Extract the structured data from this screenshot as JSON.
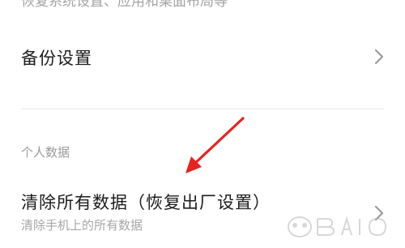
{
  "top_clipped_text": "恢复系统设置、应用和桌面布局等",
  "backup_row": {
    "title": "备份设置",
    "chevron_icon": "chevron-right-icon"
  },
  "personal_section": {
    "header": "个人数据"
  },
  "factory_reset_row": {
    "title": "清除所有数据（恢复出厂设置）",
    "subtitle": "清除手机上的所有数据",
    "chevron_icon": "chevron-right-icon"
  },
  "annotation": {
    "arrow_color": "#e8231f"
  },
  "watermark": {
    "icon": "baidu-jingyan-watermark"
  },
  "colors": {
    "background": "#ffffff",
    "title_text": "#1c1c1c",
    "secondary_text": "#a6a6a6",
    "divider": "#e6e6e6",
    "chevron": "#9b9b9b"
  }
}
